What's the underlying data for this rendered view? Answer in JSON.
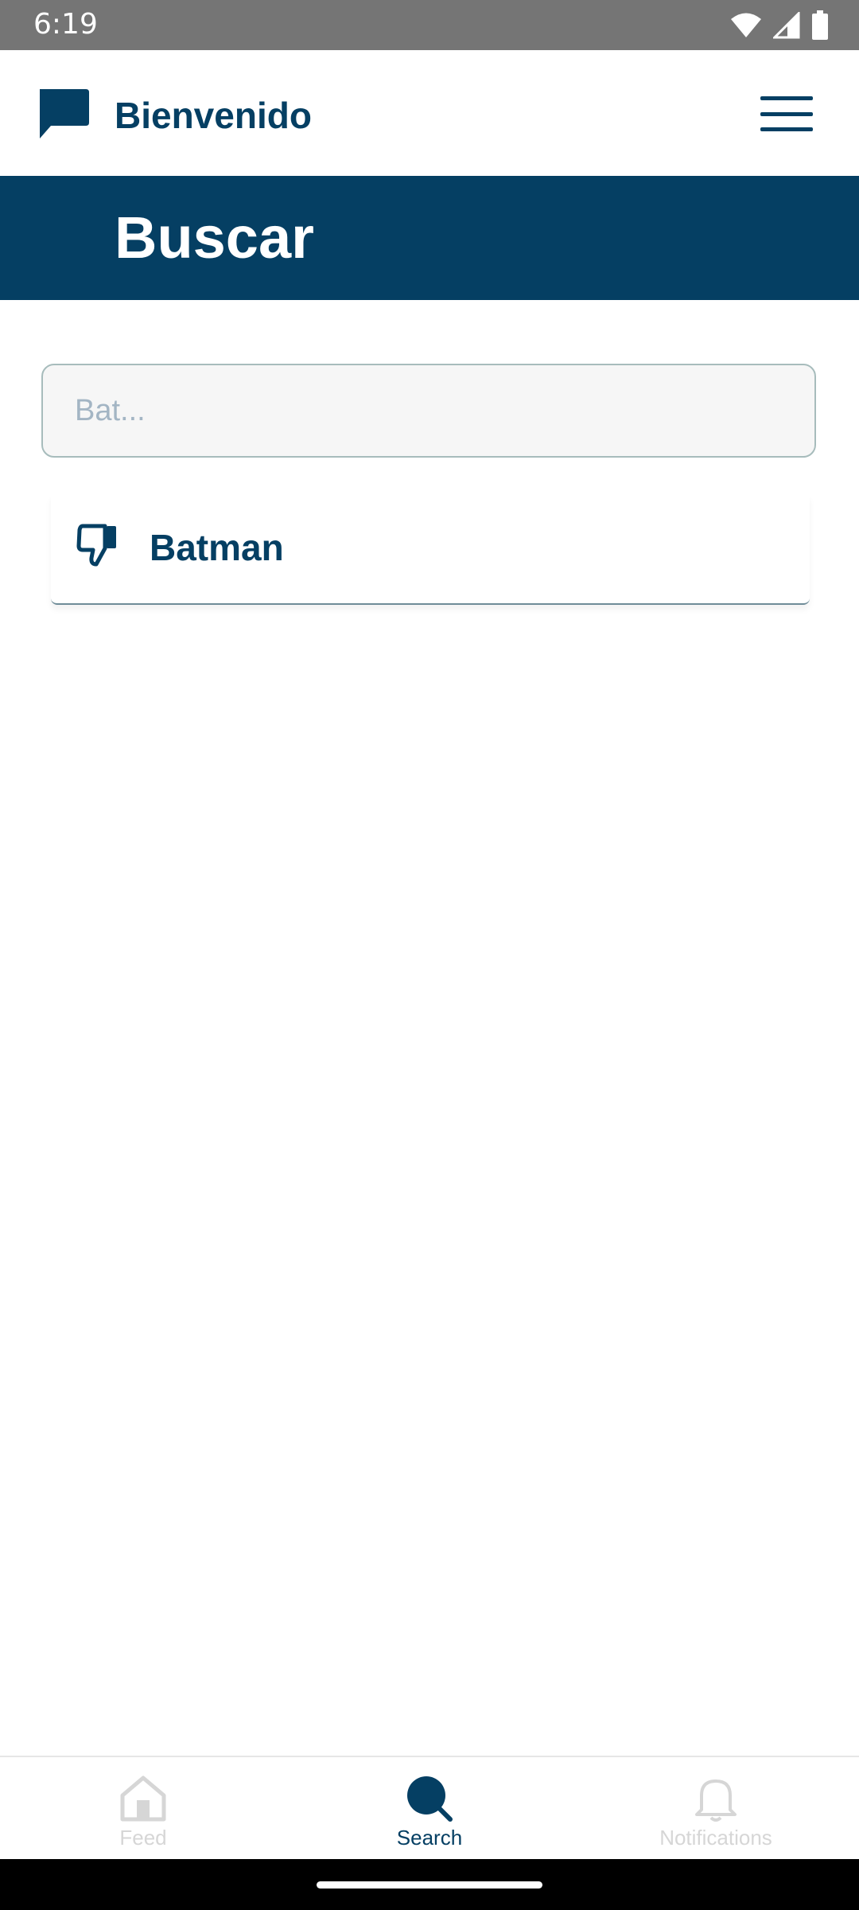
{
  "status_bar": {
    "time": "6:19",
    "icons": [
      "wifi-icon",
      "signal-icon",
      "battery-icon"
    ]
  },
  "header": {
    "logo_icon": "chat-bubble-icon",
    "title": "Bienvenido",
    "menu_icon": "hamburger-menu-icon"
  },
  "banner": {
    "title": "Buscar"
  },
  "search": {
    "placeholder": "Bat..."
  },
  "results": [
    {
      "icon": "thumbs-down-icon",
      "label": "Batman"
    }
  ],
  "bottom_nav": {
    "items": [
      {
        "label": "Feed",
        "icon": "home-icon",
        "active": false
      },
      {
        "label": "Search",
        "icon": "search-icon",
        "active": true
      },
      {
        "label": "Notifications",
        "icon": "bell-icon",
        "active": false
      }
    ]
  },
  "colors": {
    "primary": "#053f63",
    "banner_bg": "#053f63",
    "status_bar_bg": "#757575",
    "inactive_nav": "#d6d6d6",
    "input_bg": "#f6f6f6",
    "input_border": "#a7bcbc"
  }
}
